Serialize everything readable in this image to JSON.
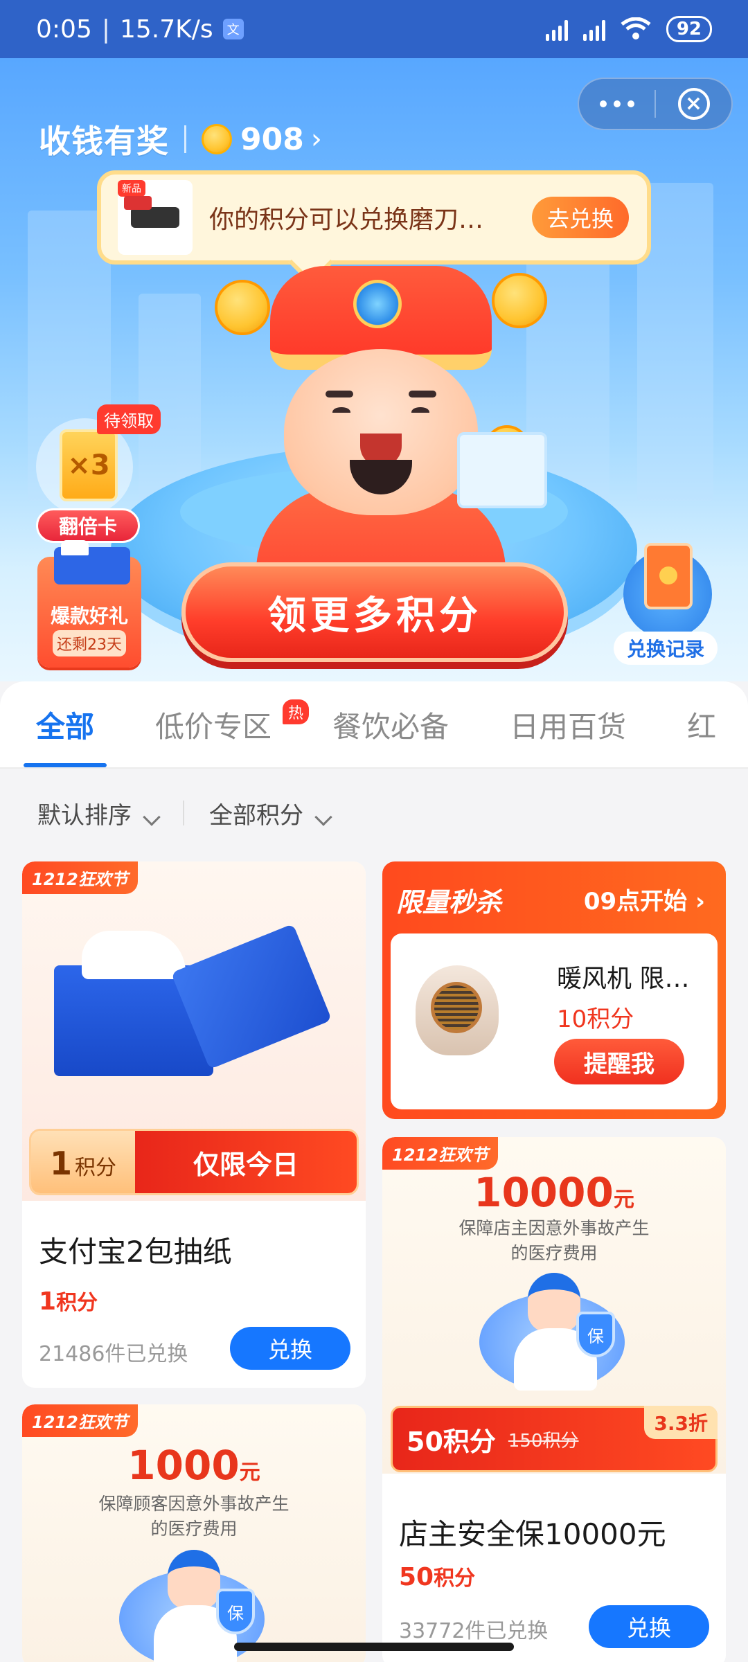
{
  "status_bar": {
    "time": "0:05",
    "speed": "15.7K/s",
    "notif_icon": "文",
    "battery": "92",
    "icons": [
      "signal-icon",
      "signal-icon",
      "wifi-icon",
      "battery-icon"
    ]
  },
  "header": {
    "title": "收钱有奖",
    "points": "908",
    "chevron": "›"
  },
  "tip": {
    "thumb_tag": "新品",
    "text": "你的积分可以兑换磨刀…",
    "button": "去兑换"
  },
  "widgets": {
    "double_card": {
      "badge": "待领取",
      "multiplier": "×3",
      "label": "翻倍卡"
    },
    "gift": {
      "title": "爆款好礼",
      "remain": "还剩23天"
    },
    "main_button": "领更多积分",
    "record": "兑换记录"
  },
  "tabs": [
    {
      "label": "全部",
      "active": true
    },
    {
      "label": "低价专区",
      "badge": "热"
    },
    {
      "label": "餐饮必备"
    },
    {
      "label": "日用百货"
    },
    {
      "label": "红"
    }
  ],
  "sort": {
    "order": "默认排序",
    "filter": "全部积分"
  },
  "products": {
    "tissue": {
      "ribbon": "1212狂欢节",
      "price_num": "1",
      "price_unit": "积分",
      "price_tag": "仅限今日",
      "name": "支付宝2包抽纸",
      "points_num": "1",
      "points_unit": "积分",
      "sold": "21486件已兑换",
      "button": "兑换"
    },
    "flash": {
      "title": "限量秒杀",
      "start": "09点开始",
      "chevron": "›",
      "name": "暖风机 限…",
      "points": "10积分",
      "button": "提醒我"
    },
    "shop_insurance": {
      "ribbon": "1212狂欢节",
      "amount": "10000",
      "amount_unit": "元",
      "desc1": "保障店主因意外事故产生",
      "desc2": "的医疗费用",
      "shield_text": "保",
      "price": "50积分",
      "orig_price": "150积分",
      "discount": "3.3折",
      "name": "店主安全保10000元",
      "points_num": "50",
      "points_unit": "积分",
      "sold": "33772件已兑换",
      "button": "兑换"
    },
    "customer_insurance": {
      "ribbon": "1212狂欢节",
      "amount": "1000",
      "amount_unit": "元",
      "desc1": "保障顾客因意外事故产生",
      "desc2": "的医疗费用",
      "shield_text": "保"
    }
  },
  "colors": {
    "primary_blue": "#1673ef",
    "accent_red": "#f0361f",
    "status_bar": "#2f63c8"
  }
}
